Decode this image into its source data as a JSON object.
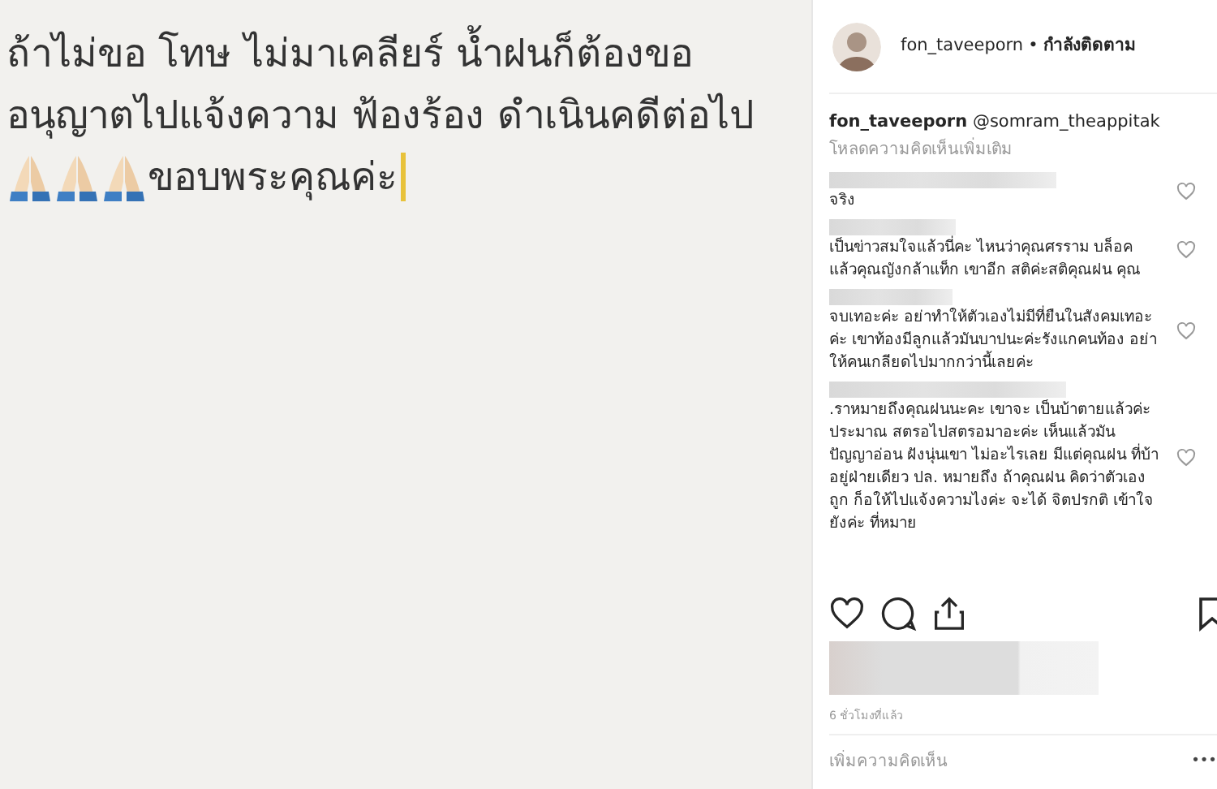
{
  "post_image": {
    "lines": [
      "ถ้าไม่ขอ โทษ ไม่มาเคลียร์ น้ำฝนก็ต้องขอ",
      "อนุญาตไปแจ้งความ ฟ้องร้อง ดำเนินคดีต่อไป"
    ],
    "closing": "ขอบพระคุณค่ะ"
  },
  "header": {
    "username": "fon_taveeporn",
    "separator": "•",
    "follow_status": "กำลังติดตาม"
  },
  "caption": {
    "username": "fon_taveeporn",
    "mention": "@somram_theappitak"
  },
  "load_more": "โหลดความคิดเห็นเพิ่มเติม",
  "comments": [
    {
      "text": "จริง"
    },
    {
      "text": "เป็นข่าวสมใจแล้วนี่คะ ไหนว่าคุณศรราม บล็อค แล้วคุณญังกล้าแท็ก เขาอีก สติค่ะสติคุณฝน คุณ"
    },
    {
      "text": "จบเทอะค่ะ อย่าทำให้ตัวเองไม่มีที่ยืนในสังคมเทอะค่ะ เขาท้องมีลูกแล้วมันบาปนะค่ะรังแกคนท้อง อย่าให้คนเกลียดไปมากกว่านี้เลยค่ะ"
    },
    {
      "text": ".ราหมายถึงคุณฝนนะคะ เขาจะ เป็นบ้าตายแล้วค่ะประมาณ สตรอไปสตรอมาอะค่ะ เห็นแล้วมันปัญญาอ่อน ฝังนุ่นเขา ไม่อะไรเลย มีแต่คุณฝน ที่บ้าอยู่ฝ่ายเดียว ปล. หมายถึง ถ้าคุณฝน คิดว่าตัวเองถูก ก็อให้ไปแจ้งความไงค่ะ จะได้ จิตปรกติ เข้าใจยังค่ะ ที่หมาย"
    }
  ],
  "time": "6 ชั่วโมงที่แล้ว",
  "add_comment": {
    "placeholder": "เพิ่มความคิดเห็น"
  },
  "more_button": "•••"
}
